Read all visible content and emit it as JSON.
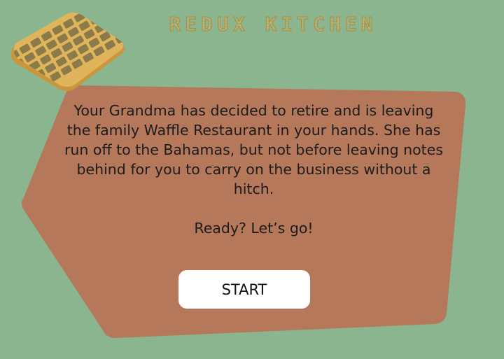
{
  "app": {
    "title": "REDUX KITCHEN"
  },
  "intro": {
    "story": "Your Grandma has decided to retire and is leaving the family Waffle Restaurant in your hands. She has run off to the Bahamas, but not before leaving notes behind for you to carry on the business without a hitch.",
    "prompt": "Ready? Let’s go!"
  },
  "actions": {
    "start_label": "START"
  },
  "colors": {
    "background": "#8bb58e",
    "panel": "#b5785b",
    "waffle": "#d8b15a",
    "button": "#ffffff"
  },
  "icons": {
    "logo": "waffle-icon"
  }
}
